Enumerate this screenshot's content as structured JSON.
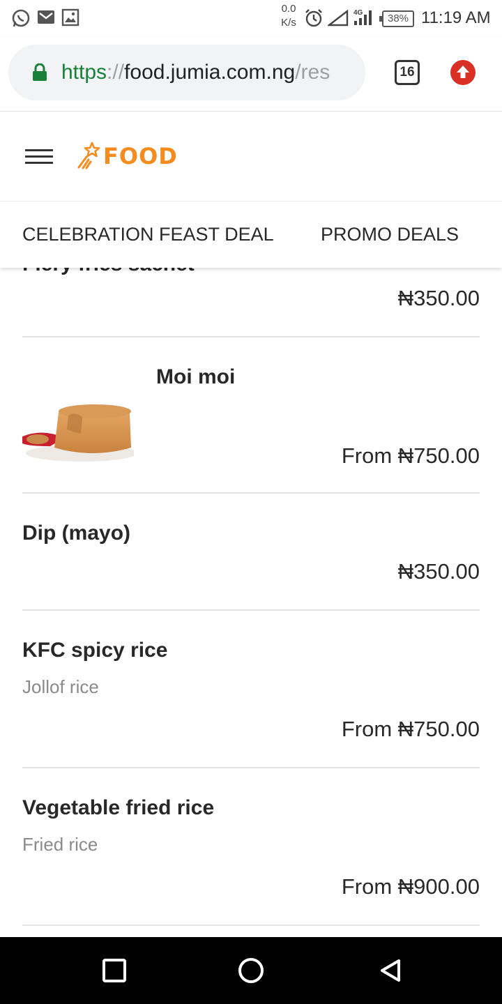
{
  "status_bar": {
    "net_speed_value": "0.0",
    "net_speed_unit": "K/s",
    "network_type": "4G",
    "battery": "38%",
    "time": "11:19 AM"
  },
  "browser": {
    "url_scheme": "https",
    "url_separator": "://",
    "url_host": "food.jumia.com.ng",
    "url_path": "/res",
    "tab_count": "16"
  },
  "header": {
    "logo_text": "FOOD"
  },
  "category_tabs": [
    {
      "label": "CELEBRATION FEAST DEAL"
    },
    {
      "label": "PROMO DEALS"
    }
  ],
  "menu_items": [
    {
      "name": "Fiery fries sachet",
      "description": "",
      "price": "₦350.00"
    },
    {
      "name": "Moi moi",
      "description": "",
      "price": "From ₦750.00"
    },
    {
      "name": "Dip (mayo)",
      "description": "",
      "price": "₦350.00"
    },
    {
      "name": "KFC spicy rice",
      "description": "Jollof rice",
      "price": "From ₦750.00"
    },
    {
      "name": "Vegetable fried rice",
      "description": "Fried rice",
      "price": "From ₦900.00"
    }
  ],
  "colors": {
    "brand_orange": "#f68b1e",
    "secure_green": "#188038",
    "update_red": "#d93025"
  }
}
